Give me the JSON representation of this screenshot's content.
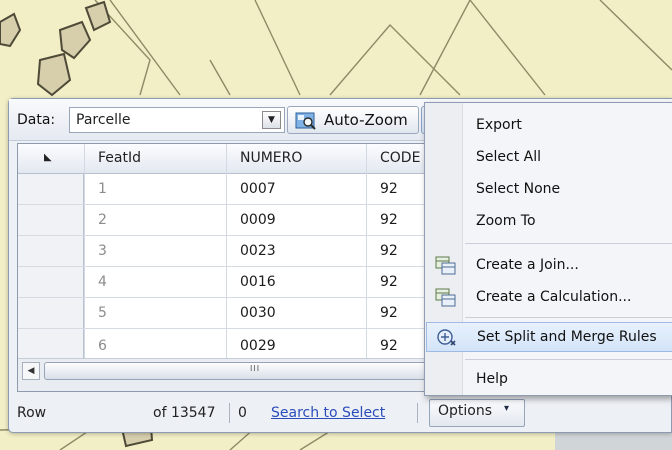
{
  "toolbar": {
    "data_label": "Data:",
    "layer_value": "Parcelle",
    "auto_zoom_label": "Auto-Zoom"
  },
  "table": {
    "columns": [
      "FeatId",
      "NUMERO",
      "CODE"
    ],
    "rows": [
      [
        "1",
        "0007",
        "92"
      ],
      [
        "2",
        "0009",
        "92"
      ],
      [
        "3",
        "0023",
        "92"
      ],
      [
        "4",
        "0016",
        "92"
      ],
      [
        "5",
        "0030",
        "92"
      ],
      [
        "6",
        "0029",
        "92"
      ]
    ],
    "scroll_grip": "III"
  },
  "status": {
    "row_label": "Row",
    "of_count": "of 13547",
    "current": "0",
    "search_link": "Search to Select",
    "options_label": "Options"
  },
  "menu": {
    "items": [
      {
        "label": "Export",
        "icon": null
      },
      {
        "label": "Select All",
        "icon": null
      },
      {
        "label": "Select None",
        "icon": null
      },
      {
        "label": "Zoom To",
        "icon": null
      },
      {
        "label": "Create a Join...",
        "icon": "join-icon"
      },
      {
        "label": "Create a Calculation...",
        "icon": "calculation-icon"
      },
      {
        "label": "Set Split and Merge Rules",
        "icon": "split-merge-icon"
      },
      {
        "label": "Help",
        "icon": null
      }
    ],
    "highlighted": "Set Split and Merge Rules"
  },
  "colors": {
    "map_background": "#f2eec6",
    "map_lines": "#6f6a4e",
    "panel": "#edf0f5",
    "menu_highlight": "#d3e4f8",
    "link": "#2b4dbb"
  }
}
